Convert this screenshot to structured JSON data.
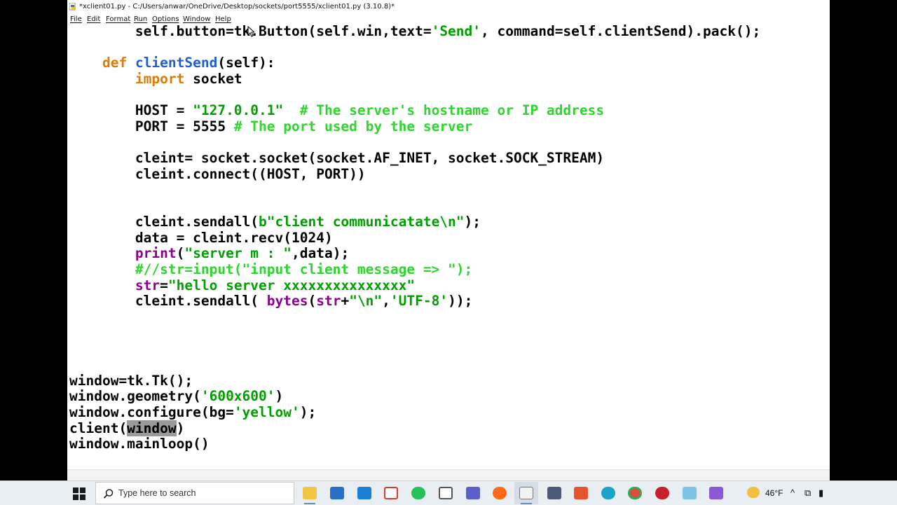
{
  "window": {
    "title": "*xclient01.py - C:/Users/anwar/OneDrive/Desktop/sockets/port5555/xclient01.py (3.10.8)*"
  },
  "menu": [
    "File",
    "Edit",
    "Format",
    "Run",
    "Options",
    "Window",
    "Help"
  ],
  "code": {
    "l1": {
      "a": "        self.",
      "b": "button=tk.Button(self.win,text=",
      "c": "'Send'",
      "d": ", command=self.clientSend).pack();"
    },
    "l2": {
      "a": "    ",
      "def": "def",
      "sp": " ",
      "name": "clientSend",
      "rest": "(self):"
    },
    "l3": {
      "a": "        ",
      "kw": "import",
      "rest": " socket"
    },
    "l4": {
      "a": "        HOST = ",
      "str": "\"127.0.0.1\"",
      "sp": "  ",
      "cmt": "# The server's hostname or IP address"
    },
    "l5": {
      "a": "        PORT = 5555 ",
      "cmt": "# The port used by the server"
    },
    "l6": "        cleint= socket.socket(socket.AF_INET, socket.SOCK_STREAM)",
    "l7": "        cleint.connect((HOST, PORT))",
    "l8": {
      "a": "        cleint.sendall(",
      "str": "b\"client communicatate\\n\"",
      "b": ");"
    },
    "l9": "        data = cleint.recv(1024)",
    "l10": {
      "a": "        ",
      "bi": "print",
      "p": "(",
      "str": "\"server m : \"",
      "b": ",data);"
    },
    "l11": {
      "a": "        ",
      "cmt": "#//str=input(\"input client message => \");"
    },
    "l12": {
      "a": "        ",
      "bi": "str",
      "eq": "=",
      "str": "\"hello server xxxxxxxxxxxxxxx\""
    },
    "l13": {
      "a": "        cleint.sendall( ",
      "bi1": "bytes",
      "p": "(",
      "bi2": "str",
      "plus": "+",
      "s1": "\"\\n\"",
      "comma": ",",
      "s2": "'UTF-8'",
      "b": "));"
    },
    "l14": "window=tk.Tk();",
    "l15": {
      "a": "window.geometry(",
      "str": "'600x600'",
      "b": ")"
    },
    "l16": {
      "a": "window.configure(bg=",
      "str": "'yellow'",
      "b": ");"
    },
    "l17": {
      "a": "client(",
      "sel": "window",
      "b": ")"
    },
    "l18": "window.mainloop()"
  },
  "taskbar": {
    "search_placeholder": "Type here to search",
    "temperature": "46°F",
    "icons": [
      "file-explorer-icon",
      "store-icon",
      "mail-icon",
      "gift-icon",
      "whatsapp-icon",
      "snipping-icon",
      "teams-icon",
      "firefox-icon",
      "python-idle-icon",
      "calculator-icon",
      "office-icon",
      "edge-icon",
      "chrome-icon",
      "devcpp-icon",
      "notepad-icon",
      "visual-studio-icon"
    ]
  },
  "colors": {
    "keyword": "#e07a00",
    "string": "#00a000",
    "comment": "#2fd52f",
    "builtin": "#900090",
    "definition": "#1f5fd0"
  }
}
